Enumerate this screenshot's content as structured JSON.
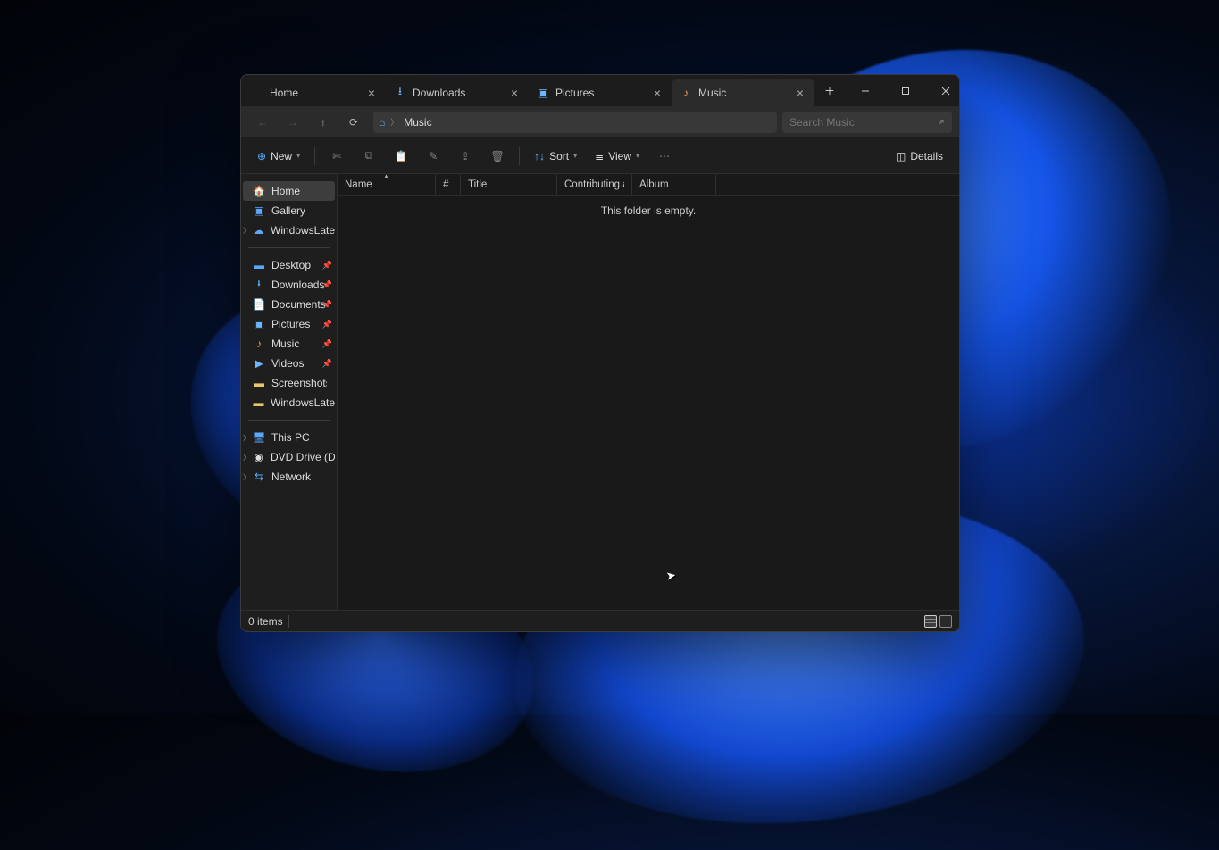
{
  "tabs": [
    {
      "label": "Home",
      "icon": ""
    },
    {
      "label": "Downloads",
      "icon": "↓"
    },
    {
      "label": "Pictures",
      "icon": "🖼"
    },
    {
      "label": "Music",
      "icon": "🎵",
      "active": true
    }
  ],
  "address": {
    "location": "Music"
  },
  "search": {
    "placeholder": "Search Music"
  },
  "toolbar": {
    "new": "New",
    "sort": "Sort",
    "view": "View",
    "details": "Details"
  },
  "sidebar": {
    "section1": [
      {
        "label": "Home",
        "icon": "🏠",
        "selected": true
      },
      {
        "label": "Gallery",
        "icon": "🖼"
      },
      {
        "label": "WindowsLatest - Pe",
        "icon": "☁",
        "expandable": true
      }
    ],
    "section2": [
      {
        "label": "Desktop",
        "icon": "🖥",
        "pinned": true
      },
      {
        "label": "Downloads",
        "icon": "↓",
        "pinned": true
      },
      {
        "label": "Documents",
        "icon": "📄",
        "pinned": true
      },
      {
        "label": "Pictures",
        "icon": "🖼",
        "pinned": true
      },
      {
        "label": "Music",
        "icon": "🎵",
        "pinned": true
      },
      {
        "label": "Videos",
        "icon": "🎬",
        "pinned": true
      },
      {
        "label": "Screenshots",
        "icon": "📁"
      },
      {
        "label": "WindowsLatest",
        "icon": "📁"
      }
    ],
    "section3": [
      {
        "label": "This PC",
        "icon": "💻",
        "expandable": true
      },
      {
        "label": "DVD Drive (D:) CCC",
        "icon": "💿",
        "expandable": true
      },
      {
        "label": "Network",
        "icon": "🖧",
        "expandable": true
      }
    ]
  },
  "columns": {
    "name": "Name",
    "num": "#",
    "title": "Title",
    "artists": "Contributing artists",
    "album": "Album"
  },
  "content": {
    "empty_message": "This folder is empty."
  },
  "status": {
    "items": "0 items"
  }
}
